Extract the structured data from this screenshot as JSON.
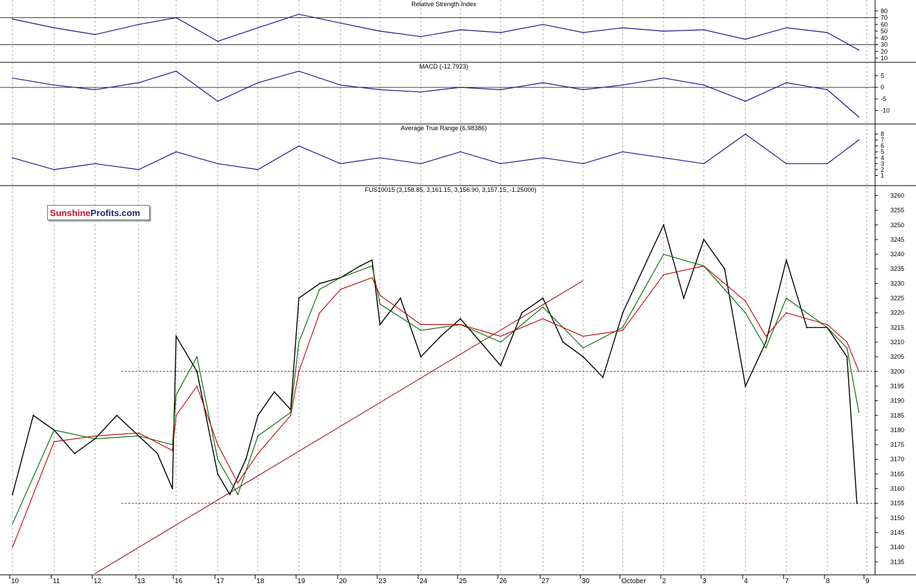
{
  "chart_data": [
    {
      "type": "line",
      "title": "Relative Strength Index",
      "y_ticks": [
        "80",
        "70",
        "60",
        "50",
        "40",
        "30",
        "20",
        "10"
      ],
      "ylim": [
        10,
        90
      ],
      "reference_levels": [
        70,
        30
      ],
      "series": [
        {
          "color": "#1a1a8c",
          "x": [
            10,
            11,
            12,
            13,
            16,
            17,
            18,
            19,
            20,
            23,
            24,
            25,
            26,
            27,
            30,
            "October",
            2,
            3,
            4,
            7,
            8,
            8.8
          ],
          "values": [
            68,
            55,
            45,
            60,
            70,
            35,
            55,
            75,
            62,
            50,
            42,
            52,
            48,
            60,
            48,
            55,
            50,
            52,
            38,
            55,
            48,
            22
          ]
        }
      ]
    },
    {
      "type": "line",
      "title": "MACD (-12.7923)",
      "y_ticks": [
        "5",
        "0",
        "-5",
        "-10"
      ],
      "ylim": [
        -14,
        9
      ],
      "reference_levels": [
        0
      ],
      "series": [
        {
          "color": "#1a1a8c",
          "x": [
            10,
            11,
            12,
            13,
            16,
            17,
            18,
            19,
            20,
            23,
            24,
            25,
            26,
            27,
            30,
            "October",
            2,
            3,
            4,
            7,
            8,
            8.8
          ],
          "values": [
            4,
            1,
            -1,
            2,
            7,
            -6,
            2,
            7,
            1,
            -1,
            -2,
            0,
            -1,
            2,
            -1,
            1,
            4,
            1,
            -6,
            2,
            -1,
            -12.8
          ]
        }
      ]
    },
    {
      "type": "line",
      "title": "Average True Range (6.98386)",
      "y_ticks": [
        "8",
        "7",
        "6",
        "5",
        "4",
        "3",
        "2",
        "1"
      ],
      "ylim": [
        0,
        9
      ],
      "series": [
        {
          "color": "#1a1a8c",
          "x": [
            10,
            11,
            12,
            13,
            16,
            17,
            18,
            19,
            20,
            23,
            24,
            25,
            26,
            27,
            30,
            "October",
            2,
            3,
            4,
            7,
            8,
            8.8
          ],
          "values": [
            4,
            2,
            3,
            2,
            5,
            3,
            2,
            6,
            3,
            4,
            3,
            5,
            3,
            4,
            3,
            5,
            4,
            3,
            8,
            3,
            3,
            7
          ]
        }
      ]
    },
    {
      "type": "line",
      "title": "FUS10015 (3,158.85, 3,161.15, 3,156.90, 3,157.15, -1.25000)",
      "x_tick_labels": [
        "10",
        "11",
        "12",
        "13",
        "16",
        "17",
        "18",
        "19",
        "20",
        "23",
        "24",
        "25",
        "26",
        "27",
        "30",
        "October",
        "2",
        "3",
        "4",
        "7",
        "8",
        "9"
      ],
      "y_ticks": [
        "3260",
        "3255",
        "3250",
        "3245",
        "3240",
        "3235",
        "3230",
        "3225",
        "3220",
        "3215",
        "3210",
        "3205",
        "3200",
        "3195",
        "3190",
        "3185",
        "3180",
        "3175",
        "3170",
        "3165",
        "3160",
        "3155",
        "3150",
        "3145",
        "3140",
        "3135"
      ],
      "ylim": [
        3132,
        3262
      ],
      "horizontal_levels": [
        3200,
        3155
      ],
      "trendline": {
        "from": [
          12,
          3131
        ],
        "to": [
          30,
          3231
        ]
      },
      "series": [
        {
          "color": "#000000",
          "x": [
            10,
            10.5,
            11,
            11.5,
            12,
            12.5,
            13,
            13.5,
            13.9,
            16,
            16.5,
            17,
            17.3,
            17.7,
            18,
            18.4,
            18.8,
            19,
            19.5,
            20,
            20.5,
            20.8,
            23,
            23.5,
            24,
            24.5,
            25,
            25.5,
            26,
            26.5,
            27,
            27.5,
            30,
            30.5,
            "October",
            2,
            2.5,
            3,
            3.5,
            4,
            4.5,
            7,
            7.5,
            8,
            8.5,
            8.75
          ],
          "values": [
            3158,
            3185,
            3180,
            3172,
            3177,
            3185,
            3178,
            3172,
            3160,
            3212,
            3200,
            3165,
            3158,
            3170,
            3185,
            3193,
            3187,
            3225,
            3230,
            3232,
            3236,
            3238,
            3216,
            3225,
            3205,
            3212,
            3218,
            3210,
            3202,
            3220,
            3225,
            3210,
            3205,
            3198,
            3220,
            3250,
            3225,
            3245,
            3235,
            3195,
            3210,
            3238,
            3215,
            3215,
            3205,
            3155
          ]
        },
        {
          "color": "#006400",
          "x": [
            10,
            11,
            12,
            13,
            13.9,
            16,
            16.5,
            17,
            17.5,
            18,
            18.8,
            19,
            19.5,
            20,
            20.8,
            23,
            24,
            25,
            26,
            27,
            30,
            "October",
            2,
            3,
            4,
            4.5,
            7,
            8,
            8.5,
            8.8
          ],
          "values": [
            3148,
            3180,
            3177,
            3178,
            3175,
            3192,
            3205,
            3170,
            3158,
            3178,
            3186,
            3210,
            3228,
            3232,
            3236,
            3223,
            3214,
            3216,
            3210,
            3222,
            3208,
            3215,
            3240,
            3236,
            3220,
            3208,
            3225,
            3215,
            3208,
            3186
          ]
        },
        {
          "color": "#c00000",
          "x": [
            10,
            11,
            12,
            13,
            13.9,
            16,
            16.5,
            17,
            17.5,
            18,
            18.8,
            19,
            19.5,
            20,
            20.8,
            23,
            24,
            25,
            26,
            27,
            30,
            "October",
            2,
            3,
            4,
            4.5,
            7,
            8,
            8.5,
            8.8
          ],
          "values": [
            3140,
            3176,
            3178,
            3179,
            3173,
            3185,
            3195,
            3175,
            3162,
            3172,
            3185,
            3200,
            3220,
            3228,
            3232,
            3226,
            3216,
            3216,
            3212,
            3218,
            3212,
            3214,
            3233,
            3236,
            3224,
            3212,
            3220,
            3216,
            3210,
            3200
          ]
        }
      ]
    }
  ],
  "logo": {
    "word1": "Sunshine",
    "word2": "Profits.com"
  }
}
